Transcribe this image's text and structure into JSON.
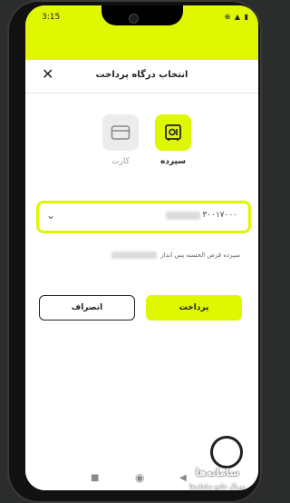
{
  "status": {
    "time": "3:15",
    "icons": "⊕ ▲ ▮"
  },
  "sheet": {
    "title": "انتخاب درگاه پرداخت",
    "close": "✕"
  },
  "methods": [
    {
      "label": "سپرده",
      "icon": "safe-icon",
      "selected": true
    },
    {
      "label": "کارت",
      "icon": "card-icon",
      "selected": false
    }
  ],
  "account": {
    "number": "۳۰۰۱۷۰۰۰"
  },
  "note": {
    "text": "سپرده قرض الحسنه پس انداز"
  },
  "buttons": {
    "pay": "پرداخت",
    "cancel": "انصراف"
  },
  "colors": {
    "accent": "#dff700"
  },
  "watermark": {
    "text": "سامانه‌ها",
    "sub": "پورتال جامع سامانه‌ها"
  }
}
